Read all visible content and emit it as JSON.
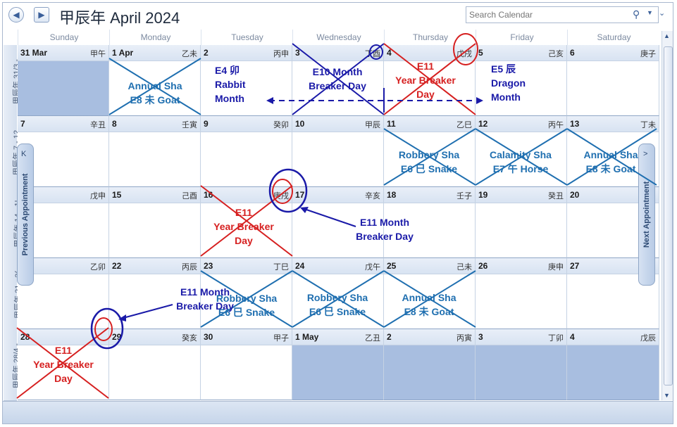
{
  "title": "甲辰年 April 2024",
  "search": {
    "placeholder": "Search Calendar"
  },
  "nav": {
    "back_icon": "◀",
    "forward_icon": "▶"
  },
  "day_headers": [
    "Sunday",
    "Monday",
    "Tuesday",
    "Wednesday",
    "Thursday",
    "Friday",
    "Saturday"
  ],
  "week_labels": [
    "甲辰年 31/3 -",
    "甲辰年 7 - 12",
    "甲辰年 14 - 1!",
    "甲辰年 21 - 2(",
    "甲辰年 28/4 -"
  ],
  "weeks": [
    [
      {
        "d": "31 Mar",
        "gz": "甲午"
      },
      {
        "d": "1 Apr",
        "gz": "乙未"
      },
      {
        "d": "2",
        "gz": "丙申"
      },
      {
        "d": "3",
        "gz": "丁酉"
      },
      {
        "d": "4",
        "gz": "戊戌"
      },
      {
        "d": "5",
        "gz": "己亥"
      },
      {
        "d": "6",
        "gz": "庚子"
      }
    ],
    [
      {
        "d": "7",
        "gz": "辛丑"
      },
      {
        "d": "8",
        "gz": "壬寅"
      },
      {
        "d": "9",
        "gz": "癸卯"
      },
      {
        "d": "10",
        "gz": "甲辰"
      },
      {
        "d": "11",
        "gz": "乙巳"
      },
      {
        "d": "12",
        "gz": "丙午"
      },
      {
        "d": "13",
        "gz": "丁未"
      }
    ],
    [
      {
        "d": "",
        "gz": "戊申"
      },
      {
        "d": "15",
        "gz": "己酉"
      },
      {
        "d": "16",
        "gz": "庚戌"
      },
      {
        "d": "17",
        "gz": "辛亥"
      },
      {
        "d": "18",
        "gz": "壬子"
      },
      {
        "d": "19",
        "gz": "癸丑"
      },
      {
        "d": "20",
        "gz": ""
      }
    ],
    [
      {
        "d": "",
        "gz": "乙卯"
      },
      {
        "d": "22",
        "gz": "丙辰"
      },
      {
        "d": "23",
        "gz": "丁巳"
      },
      {
        "d": "24",
        "gz": "戊午"
      },
      {
        "d": "25",
        "gz": "己未"
      },
      {
        "d": "26",
        "gz": "庚申"
      },
      {
        "d": "27",
        "gz": ""
      }
    ],
    [
      {
        "d": "28",
        "gz": ""
      },
      {
        "d": "29",
        "gz": "癸亥"
      },
      {
        "d": "30",
        "gz": "甲子"
      },
      {
        "d": "1 May",
        "gz": "乙丑"
      },
      {
        "d": "2",
        "gz": "丙寅"
      },
      {
        "d": "3",
        "gz": "丁卯"
      },
      {
        "d": "4",
        "gz": "戊辰"
      }
    ]
  ],
  "annotations": {
    "annual_sha_goat_1": "Annual Sha\nE8 未 Goat",
    "rabbit_month": "E4 卯\nRabbit\nMonth",
    "e10_month_breaker": "E10 Month\nBreaker Day",
    "e11_year_breaker_1": "E11\nYear Breaker\nDay",
    "dragon_month": "E5 辰\nDragon\nMonth",
    "robbery_sha_1": "Robbery Sha\nE6 巳 Snake",
    "calamity_sha": "Calamity Sha\nE7 午 Horse",
    "annual_sha_goat_2": "Annual Sha\nE8 未 Goat",
    "e11_year_breaker_2": "E11\nYear Breaker\nDay",
    "e11_month_breaker_1": "E11 Month\nBreaker Day",
    "e11_month_breaker_2": "E11 Month\nBreaker Day",
    "robbery_sha_2": "Robbery Sha\nE6 巳 Snake",
    "robbery_sha_3": "Robbery Sha\nE6 巳 Snake",
    "annual_sha_goat_3": "Annual Sha\nE8 未 Goat",
    "e11_year_breaker_3": "E11\nYear Breaker\nDay"
  },
  "side_tabs": {
    "previous": "Previous Appointment",
    "next": "Next Appointment"
  },
  "colors": {
    "red": "#d62020",
    "navy": "#1a1aa8",
    "teal": "#1f6fb0",
    "shade": "#a8bee0"
  }
}
